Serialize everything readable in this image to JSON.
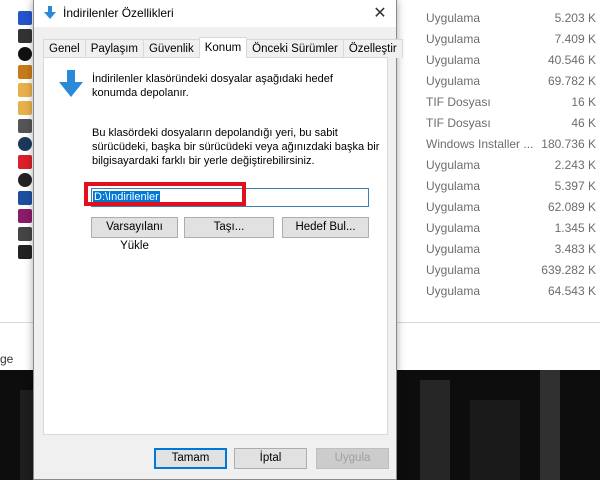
{
  "dialog": {
    "title": "İndirilenler Özellikleri",
    "tabs": [
      {
        "label": "Genel",
        "active": false
      },
      {
        "label": "Paylaşım",
        "active": false
      },
      {
        "label": "Güvenlik",
        "active": false
      },
      {
        "label": "Konum",
        "active": true
      },
      {
        "label": "Önceki Sürümler",
        "active": false
      },
      {
        "label": "Özelleştir",
        "active": false
      }
    ],
    "location_tab": {
      "intro_text": "İndirilenler klasöründeki dosyalar aşağıdaki hedef konumda depolanır.",
      "explain_text": "Bu klasördeki dosyaların depolandığı yeri, bu sabit sürücüdeki, başka bir sürücüdeki veya ağınızdaki başka bir bilgisayardaki farklı bir yerle değiştirebilirsiniz.",
      "path_value": "D:\\İndirilenler",
      "buttons": {
        "reset": "Varsayılanı Yükle",
        "move": "Taşı...",
        "find_target": "Hedef Bul..."
      }
    },
    "footer": {
      "ok": "Tamam",
      "cancel": "İptal",
      "apply": "Uygula"
    }
  },
  "background_list": [
    {
      "type": "Uygulama",
      "size": "5.203 K"
    },
    {
      "type": "Uygulama",
      "size": "7.409 K"
    },
    {
      "type": "Uygulama",
      "size": "40.546 K"
    },
    {
      "type": "Uygulama",
      "size": "69.782 K"
    },
    {
      "type": "TIF Dosyası",
      "size": "16 K"
    },
    {
      "type": "TIF Dosyası",
      "size": "46 K"
    },
    {
      "type": "Windows Installer ...",
      "size": "180.736 K"
    },
    {
      "type": "Uygulama",
      "size": "2.243 K"
    },
    {
      "type": "Uygulama",
      "size": "5.397 K"
    },
    {
      "type": "Uygulama",
      "size": "62.089 K"
    },
    {
      "type": "Uygulama",
      "size": "1.345 K"
    },
    {
      "type": "Uygulama",
      "size": "3.483 K"
    },
    {
      "type": "Uygulama",
      "size": "639.282 K"
    },
    {
      "type": "Uygulama",
      "size": "64.543 K"
    }
  ],
  "background_fragment": "ge",
  "colors": {
    "accent": "#0078d7",
    "highlight_box": "#e0101c",
    "arrow_blue": "#2b8ad8"
  }
}
